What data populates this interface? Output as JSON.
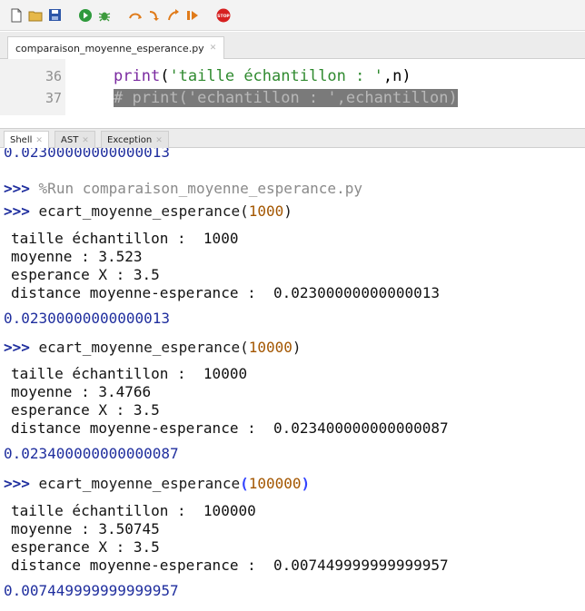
{
  "toolbar": {
    "icons": [
      "new-file-icon",
      "open-folder-icon",
      "save-icon",
      "run-icon",
      "debug-icon",
      "step-over-icon",
      "step-into-icon",
      "step-out-icon",
      "resume-icon",
      "stop-icon"
    ],
    "stop_label": "STOP"
  },
  "editor": {
    "tab_label": "comparaison_moyenne_esperance.py",
    "lines": [
      {
        "number": "36",
        "kw": "print",
        "open": "(",
        "str": "'taille échantillon : '",
        "rest": ",n)"
      },
      {
        "number": "37",
        "comment": "# print('echantillon : ',echantillon)"
      }
    ]
  },
  "shell_tabs": [
    "Shell",
    "AST",
    "Exception"
  ],
  "shell": {
    "top_value": "0.02300000000000013",
    "prompt": ">>>",
    "run_cmd": "%Run comparaison_moyenne_esperance.py",
    "func_name": "ecart_moyenne_esperance",
    "blocks": [
      {
        "arg": "1000",
        "out1": "taille échantillon :  1000",
        "out2": "moyenne : 3.523",
        "out3": "esperance X : 3.5",
        "out4": "distance moyenne-esperance :  0.02300000000000013",
        "ret": "0.02300000000000013"
      },
      {
        "arg": "10000",
        "out1": "taille échantillon :  10000",
        "out2": "moyenne : 3.4766",
        "out3": "esperance X : 3.5",
        "out4": "distance moyenne-esperance :  0.023400000000000087",
        "ret": "0.023400000000000087"
      },
      {
        "arg": "100000",
        "out1": "taille échantillon :  100000",
        "out2": "moyenne : 3.50745",
        "out3": "esperance X : 3.5",
        "out4": "distance moyenne-esperance :  0.007449999999999957",
        "ret": "0.007449999999999957"
      }
    ]
  }
}
